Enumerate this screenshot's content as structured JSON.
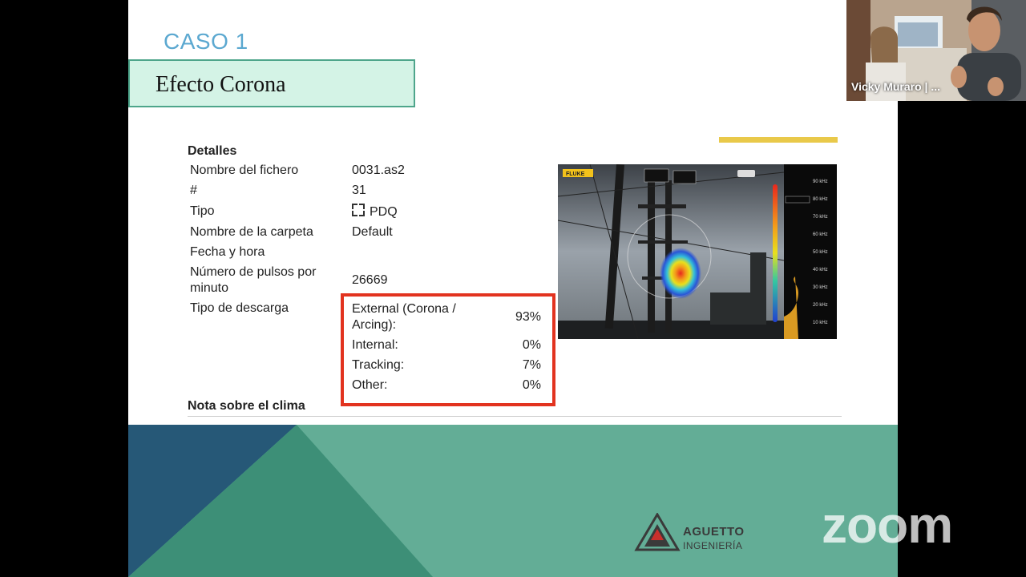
{
  "slide": {
    "caso": "CASO 1",
    "title": "Efecto Corona",
    "details_heading": "Detalles",
    "rows": [
      {
        "label": "Nombre del fichero",
        "value": "0031.as2"
      },
      {
        "label": "#",
        "value": "31"
      },
      {
        "label": "Tipo",
        "value": "PDQ"
      },
      {
        "label": "Nombre de la carpeta",
        "value": "Default"
      },
      {
        "label": "Fecha y hora",
        "value": ""
      },
      {
        "label": "Número de pulsos por minuto",
        "value": "26669"
      },
      {
        "label": "Tipo de descarga",
        "value": ""
      }
    ],
    "discharge": [
      {
        "label": "External (Corona / Arcing):",
        "value": "93%"
      },
      {
        "label": "Internal:",
        "value": "0%"
      },
      {
        "label": "Tracking:",
        "value": "7%"
      },
      {
        "label": "Other:",
        "value": "0%"
      }
    ],
    "weather_note": "Nota sobre el clima",
    "thermal_image": {
      "brand": "FLUKE",
      "scale": [
        "90 kHz",
        "80 kHz",
        "70 kHz",
        "60 kHz",
        "50 kHz",
        "40 kHz",
        "30 kHz",
        "20 kHz",
        "10 kHz"
      ]
    },
    "logo": {
      "line1": "AGUETTO",
      "line2": "INGENIERÍA"
    }
  },
  "zoom": {
    "watermark": "zoom"
  },
  "participant": {
    "name": "Vicky Muraro | ..."
  },
  "colors": {
    "teal": "#63ad96",
    "dark_blue": "#265877",
    "green": "#3d8f77",
    "red_box": "#e2331f",
    "caso_blue": "#5ba8d0"
  }
}
